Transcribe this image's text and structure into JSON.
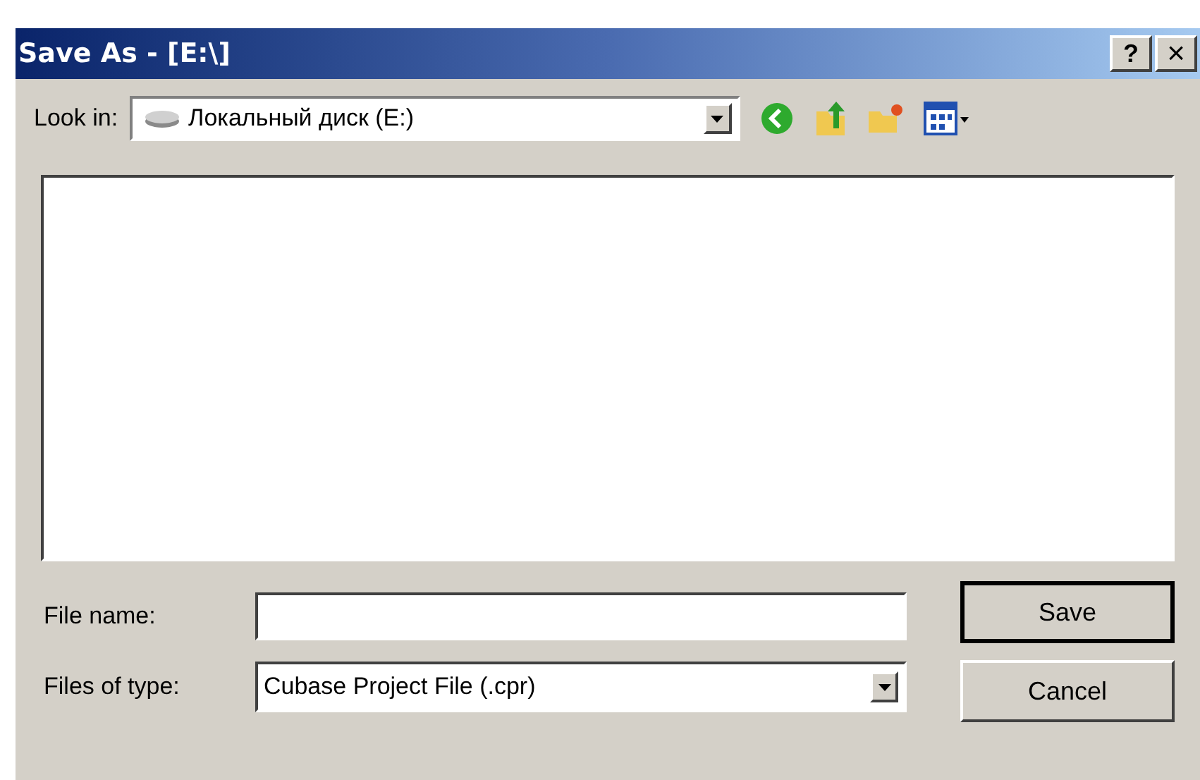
{
  "window": {
    "title": "Save As - [E:\\]",
    "help_button": "?",
    "close_button": "×"
  },
  "look_in": {
    "label": "Look in:",
    "value": "Локальный диск (E:)"
  },
  "file_name": {
    "label": "File name:"
  },
  "files_of_type": {
    "label": "Files of type:",
    "value": "Cubase Project File (.cpr)"
  },
  "buttons": [
    {
      "label": "Save",
      "default": true
    },
    {
      "label": "Cancel",
      "default": false
    }
  ]
}
